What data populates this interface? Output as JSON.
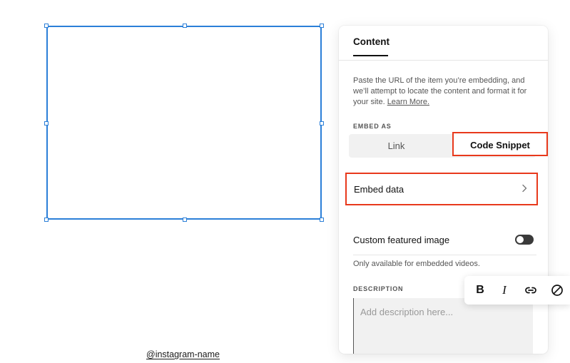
{
  "canvas": {
    "caption_link": "@instagram-name"
  },
  "panel": {
    "tab_content": "Content",
    "description_text": "Paste the URL of the item you’re embedding, and we’ll attempt to locate the content and format it for your site.",
    "learn_more": "Learn More.",
    "embed_as_label": "EMBED AS",
    "embed_as_options": [
      "Link",
      "Code Snippet"
    ],
    "embed_as_selected": "Code Snippet",
    "embed_data_label": "Embed data",
    "custom_featured_label": "Custom featured image",
    "custom_featured_note": "Only available for embedded videos.",
    "description_label": "DESCRIPTION",
    "description_placeholder": "Add description here..."
  },
  "format_toolbar": {
    "bold": "B",
    "italic": "I",
    "icons": [
      "bold-icon",
      "italic-icon",
      "link-icon",
      "clear-format-icon"
    ]
  },
  "colors": {
    "selection_blue": "#2b7fd8",
    "highlight_red": "#e8391c",
    "toggle_off": "#3a3a3a"
  }
}
